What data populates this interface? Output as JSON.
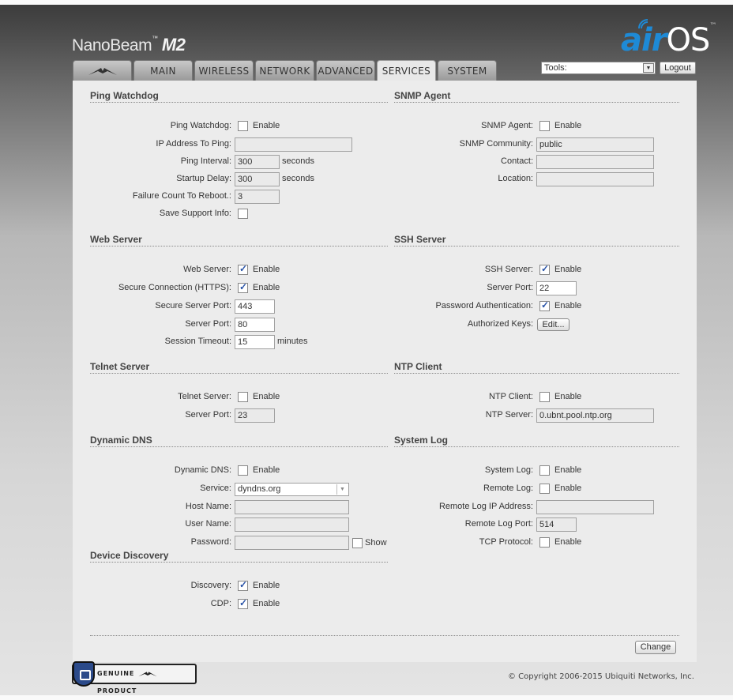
{
  "header": {
    "product_name": "NanoBeam",
    "product_tm": "™",
    "product_model": "M2",
    "brand_air": "air",
    "brand_os": "OS",
    "brand_tm": "™",
    "tools_label": "Tools:",
    "logout_label": "Logout"
  },
  "tabs": [
    {
      "label": "MAIN"
    },
    {
      "label": "WIRELESS"
    },
    {
      "label": "NETWORK"
    },
    {
      "label": "ADVANCED"
    },
    {
      "label": "SERVICES",
      "active": true
    },
    {
      "label": "SYSTEM"
    }
  ],
  "ping_watchdog": {
    "title": "Ping Watchdog",
    "watchdog_label": "Ping Watchdog:",
    "enable": "Enable",
    "ip_label": "IP Address To Ping:",
    "ip_value": "",
    "interval_label": "Ping Interval:",
    "interval_value": "300",
    "startup_label": "Startup Delay:",
    "startup_value": "300",
    "seconds": "seconds",
    "failure_label": "Failure Count To Reboot.:",
    "failure_value": "3",
    "support_label": "Save Support Info:"
  },
  "snmp": {
    "title": "SNMP Agent",
    "agent_label": "SNMP Agent:",
    "enable": "Enable",
    "community_label": "SNMP Community:",
    "community_value": "public",
    "contact_label": "Contact:",
    "contact_value": "",
    "location_label": "Location:",
    "location_value": ""
  },
  "web_server": {
    "title": "Web Server",
    "server_label": "Web Server:",
    "enable": "Enable",
    "https_label": "Secure Connection (HTTPS):",
    "secure_port_label": "Secure Server Port:",
    "secure_port_value": "443",
    "port_label": "Server Port:",
    "port_value": "80",
    "timeout_label": "Session Timeout:",
    "timeout_value": "15",
    "minutes": "minutes"
  },
  "ssh": {
    "title": "SSH Server",
    "server_label": "SSH Server:",
    "enable": "Enable",
    "port_label": "Server Port:",
    "port_value": "22",
    "password_label": "Password Authentication:",
    "keys_label": "Authorized Keys:",
    "edit_label": "Edit..."
  },
  "telnet": {
    "title": "Telnet Server",
    "server_label": "Telnet Server:",
    "enable": "Enable",
    "port_label": "Server Port:",
    "port_value": "23"
  },
  "ntp": {
    "title": "NTP Client",
    "client_label": "NTP Client:",
    "enable": "Enable",
    "server_label": "NTP Server:",
    "server_value": "0.ubnt.pool.ntp.org"
  },
  "ddns": {
    "title": "Dynamic DNS",
    "ddns_label": "Dynamic DNS:",
    "enable": "Enable",
    "service_label": "Service:",
    "service_value": "dyndns.org",
    "host_label": "Host Name:",
    "host_value": "",
    "user_label": "User Name:",
    "user_value": "",
    "password_label": "Password:",
    "password_value": "",
    "show": "Show"
  },
  "syslog": {
    "title": "System Log",
    "system_log_label": "System Log:",
    "enable": "Enable",
    "remote_log_label": "Remote Log:",
    "remote_ip_label": "Remote Log IP Address:",
    "remote_ip_value": "",
    "remote_port_label": "Remote Log Port:",
    "remote_port_value": "514",
    "tcp_label": "TCP Protocol:"
  },
  "discovery": {
    "title": "Device Discovery",
    "discovery_label": "Discovery:",
    "enable": "Enable",
    "cdp_label": "CDP:"
  },
  "actions": {
    "change_label": "Change"
  },
  "footer": {
    "genuine_text": "GENUINE ",
    "product_text": " PRODUCT",
    "copyright": "© Copyright 2006-2015 Ubiquiti Networks, Inc."
  },
  "colors": {
    "accent": "#1e8ad6",
    "panel": "#ececec",
    "checkmark": "#2a54a8"
  }
}
